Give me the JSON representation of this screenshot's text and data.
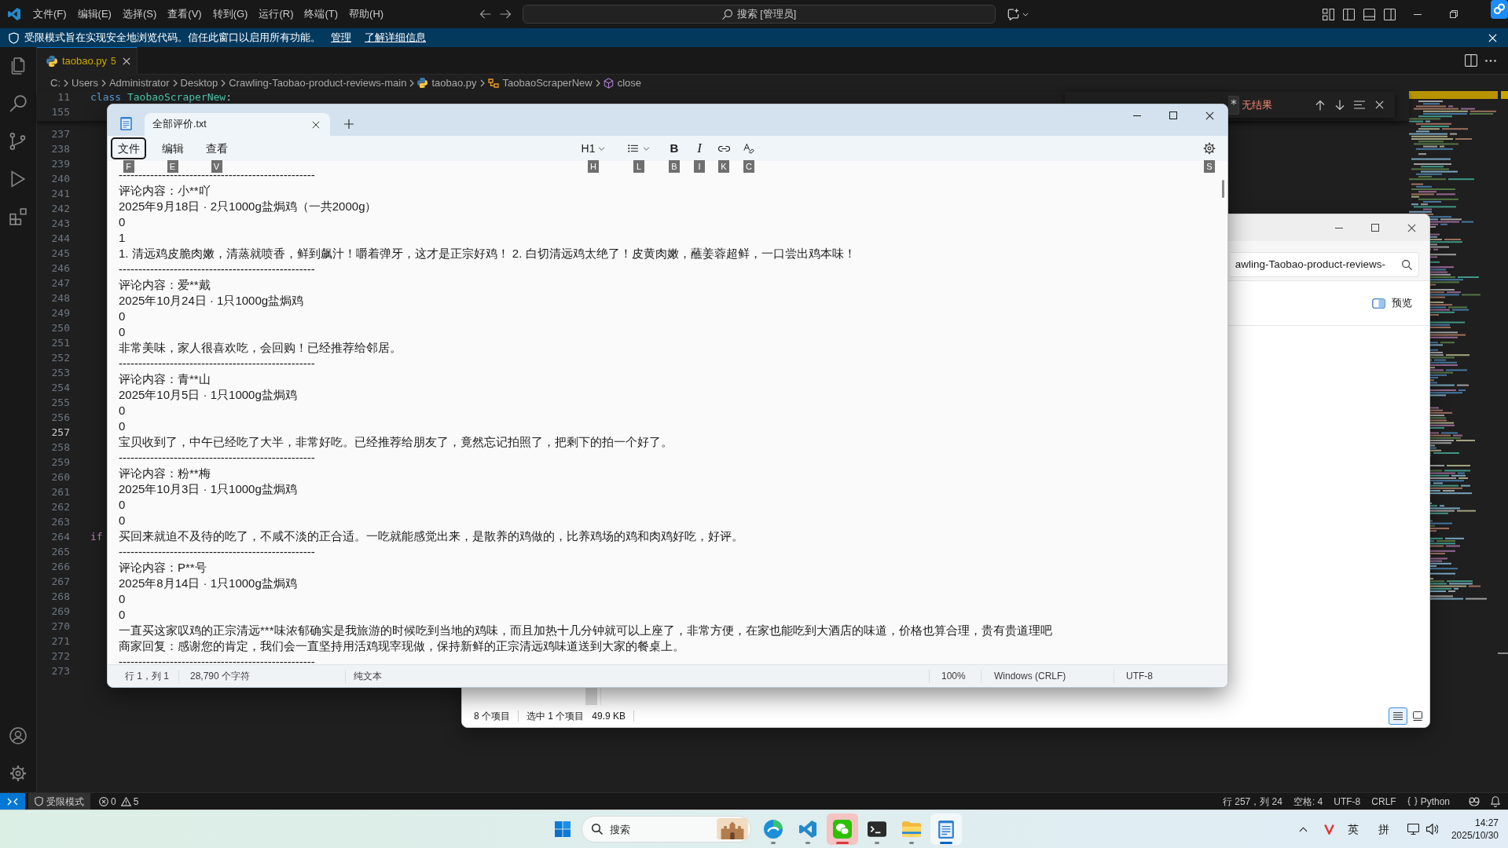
{
  "code_editor": {
    "menu": [
      "文件(F)",
      "编辑(E)",
      "选择(S)",
      "查看(V)",
      "转到(G)",
      "运行(R)",
      "终端(T)",
      "帮助(H)"
    ],
    "command_center": "搜索 [管理员]",
    "banner": {
      "message": "受限模式旨在实现安全地浏览代码。信任此窗口以启用所有功能。",
      "links": [
        "管理",
        "了解详细信息"
      ]
    },
    "tabs": [
      {
        "label": "taobao.py",
        "problems": "5",
        "selected": true
      }
    ],
    "breadcrumb": [
      {
        "label": "C:",
        "kind": "folder"
      },
      {
        "label": "Users",
        "kind": "folder"
      },
      {
        "label": "Administrator",
        "kind": "folder"
      },
      {
        "label": "Desktop",
        "kind": "folder"
      },
      {
        "label": "Crawling-Taobao-product-reviews-main",
        "kind": "folder"
      },
      {
        "label": "taobao.py",
        "kind": "file"
      },
      {
        "label": "TaobaoScraperNew",
        "kind": "class"
      },
      {
        "label": "close",
        "kind": "method"
      }
    ],
    "sticky_lines": [
      {
        "number": "11",
        "tokens": [
          {
            "text": "class",
            "kind": "keyword"
          },
          {
            "text": "TaobaoScraperNew",
            "kind": "type"
          },
          {
            "text": ":",
            "kind": "plain"
          }
        ]
      },
      {
        "number": "155"
      }
    ],
    "lines": [
      {
        "number": "237",
        "current": false
      },
      {
        "number": "238",
        "current": false
      },
      {
        "number": "239",
        "current": false
      },
      {
        "number": "240",
        "current": false
      },
      {
        "number": "241",
        "current": false
      },
      {
        "number": "242",
        "current": false
      },
      {
        "number": "243",
        "current": false
      },
      {
        "number": "244",
        "current": false
      },
      {
        "number": "245",
        "current": false
      },
      {
        "number": "246",
        "current": false
      },
      {
        "number": "247",
        "current": false
      },
      {
        "number": "248",
        "current": false
      },
      {
        "number": "249",
        "current": false
      },
      {
        "number": "250",
        "current": false
      },
      {
        "number": "251",
        "current": false
      },
      {
        "number": "252",
        "current": false
      },
      {
        "number": "253",
        "current": false
      },
      {
        "number": "254",
        "current": false
      },
      {
        "number": "255",
        "current": false
      },
      {
        "number": "256",
        "current": false
      },
      {
        "number": "257",
        "current": true
      },
      {
        "number": "258",
        "current": false
      },
      {
        "number": "259",
        "current": false
      },
      {
        "number": "260",
        "current": false
      },
      {
        "number": "261",
        "current": false
      },
      {
        "number": "262",
        "current": false
      },
      {
        "number": "263",
        "current": false
      },
      {
        "number": "264",
        "current": false,
        "tokens": [
          {
            "text": "if",
            "kind": "control"
          }
        ]
      },
      {
        "number": "265",
        "current": false
      },
      {
        "number": "266",
        "current": false
      },
      {
        "number": "267",
        "current": false
      },
      {
        "number": "268",
        "current": false
      },
      {
        "number": "269",
        "current": false
      },
      {
        "number": "270",
        "current": false
      },
      {
        "number": "271",
        "current": false
      },
      {
        "number": "272",
        "current": false
      },
      {
        "number": "273",
        "current": false
      }
    ],
    "find_widget": {
      "result": "无结果"
    },
    "status_bar": {
      "restricted": "受限模式",
      "errors": "0",
      "warnings": "5",
      "position": "行 257，列 24",
      "indentation": "空格: 4",
      "encoding": "UTF-8",
      "line_ending": "CRLF",
      "language": "Python"
    }
  },
  "explorer": {
    "address": "awling-Taobao-product-reviews-",
    "preview": "预览",
    "status_bar": {
      "items": "8 个项目",
      "selection": "选中 1 个项目",
      "size": "49.9 KB"
    },
    "views": [
      {
        "kind": "details",
        "selected": true
      },
      {
        "kind": "tiles",
        "selected": false
      }
    ]
  },
  "notepad": {
    "tabs": [
      {
        "label": "全部评价.txt",
        "selected": true
      }
    ],
    "menu": [
      {
        "label": "文件",
        "key": "F",
        "selected": true
      },
      {
        "label": "编辑",
        "key": "E",
        "selected": false
      },
      {
        "label": "查看",
        "key": "V",
        "selected": false
      }
    ],
    "toolbar": [
      {
        "kind": "heading",
        "label": "H1",
        "key": "H"
      },
      {
        "kind": "list",
        "key": "L"
      },
      {
        "kind": "bold",
        "label": "B",
        "key": "B"
      },
      {
        "kind": "italic",
        "label": "I",
        "key": "I"
      },
      {
        "kind": "link",
        "key": "K"
      },
      {
        "kind": "clear_formatting",
        "key": "C"
      },
      {
        "kind": "settings",
        "key": "S"
      }
    ],
    "lines": [
      "--------------------------------------------------",
      "评论内容：小**吖",
      "2025年9月18日 · 2只1000g盐焗鸡（一共2000g）",
      "0",
      "1",
      "1. 清远鸡皮脆肉嫩，清蒸就喷香，鲜到飙汁！嚼着弹牙，这才是正宗好鸡！ 2. 白切清远鸡太绝了！皮黄肉嫩，蘸姜蓉超鲜，一口尝出鸡本味！",
      "--------------------------------------------------",
      "评论内容：爱**戴",
      "2025年10月24日 · 1只1000g盐焗鸡",
      "0",
      "0",
      "非常美味，家人很喜欢吃，会回购！已经推荐给邻居。",
      "--------------------------------------------------",
      "评论内容：青**山",
      "2025年10月5日 · 1只1000g盐焗鸡",
      "0",
      "0",
      "宝贝收到了，中午已经吃了大半，非常好吃。已经推荐给朋友了，竟然忘记拍照了，把剩下的拍一个好了。",
      "--------------------------------------------------",
      "评论内容：粉**梅",
      "2025年10月3日 · 1只1000g盐焗鸡",
      "0",
      "0",
      "买回来就迫不及待的吃了，不咸不淡的正合适。一吃就能感觉出来，是散养的鸡做的，比养鸡场的鸡和肉鸡好吃，好评。",
      "--------------------------------------------------",
      "评论内容：P**号",
      "2025年8月14日 · 1只1000g盐焗鸡",
      "0",
      "0",
      "一直买这家叹鸡的正宗清远***味浓郁确实是我旅游的时候吃到当地的鸡味，而且加热十几分钟就可以上座了，非常方便，在家也能吃到大酒店的味道，价格也算合理，贵有贵道理吧",
      "商家回复：感谢您的肯定，我们会一直坚持用活鸡现宰现做，保持新鲜的正宗清远鸡味道送到大家的餐桌上。",
      "--------------------------------------------------"
    ],
    "status_bar": {
      "position": "行 1，列 1",
      "characters": "28,790 个字符",
      "format": "纯文本",
      "zoom": "100%",
      "line_ending": "Windows (CRLF)",
      "encoding": "UTF-8"
    }
  },
  "taskbar": {
    "search": {
      "placeholder": "搜索"
    },
    "apps": [
      {
        "kind": "browser",
        "running": true,
        "selected": false,
        "flashing": false
      },
      {
        "kind": "code_editor",
        "running": true,
        "selected": false,
        "flashing": false
      },
      {
        "kind": "chat",
        "running": true,
        "selected": false,
        "flashing": true
      },
      {
        "kind": "terminal",
        "running": true,
        "selected": false,
        "flashing": false
      },
      {
        "kind": "files",
        "running": true,
        "selected": false,
        "flashing": false
      },
      {
        "kind": "notepad",
        "running": true,
        "selected": true,
        "flashing": false
      }
    ],
    "tray": {
      "input_language": "英",
      "input_mode": "拼"
    },
    "clock": {
      "time": "14:27",
      "date": "2025/10/30"
    }
  }
}
